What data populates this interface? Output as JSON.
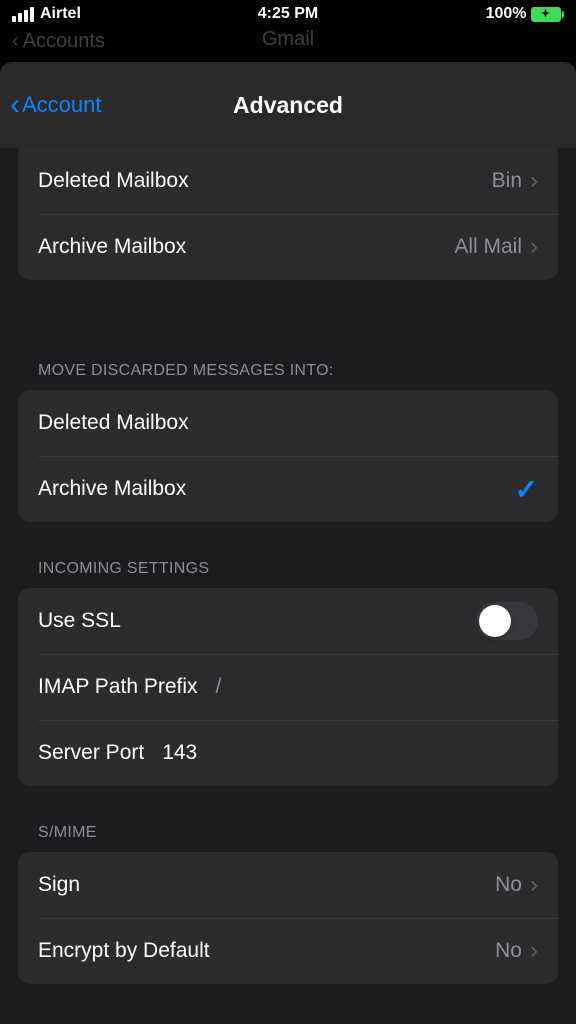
{
  "status": {
    "carrier": "Airtel",
    "time": "4:25 PM",
    "battery_pct": "100%"
  },
  "ghost": {
    "back": "Accounts",
    "title": "Gmail"
  },
  "nav": {
    "back_label": "Account",
    "title": "Advanced"
  },
  "mailbox_rows": {
    "deleted_label": "Deleted Mailbox",
    "deleted_value": "Bin",
    "archive_label": "Archive Mailbox",
    "archive_value": "All Mail"
  },
  "discarded": {
    "header": "MOVE DISCARDED MESSAGES INTO:",
    "option_deleted": "Deleted Mailbox",
    "option_archive": "Archive Mailbox",
    "selected": "archive"
  },
  "incoming": {
    "header": "INCOMING SETTINGS",
    "use_ssl_label": "Use SSL",
    "use_ssl_on": false,
    "imap_prefix_label": "IMAP Path Prefix",
    "imap_prefix_value": "/",
    "server_port_label": "Server Port",
    "server_port_value": "143"
  },
  "smime": {
    "header": "S/MIME",
    "sign_label": "Sign",
    "sign_value": "No",
    "encrypt_label": "Encrypt by Default",
    "encrypt_value": "No"
  }
}
